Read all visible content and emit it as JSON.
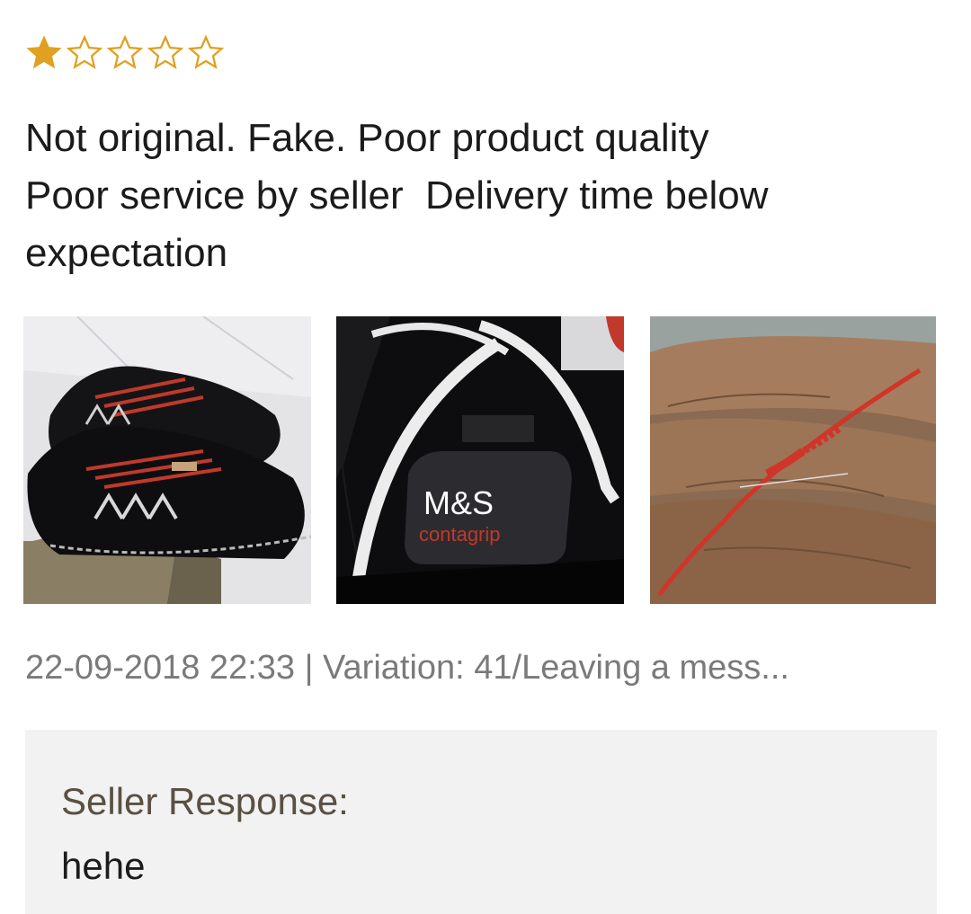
{
  "rating": {
    "value": 1,
    "max": 5,
    "filled_color": "#e0a020",
    "empty_color": "#e0a020"
  },
  "review": {
    "lines": [
      "Not original. Fake. Poor product quality",
      "Poor service by seller  Delivery time below",
      "expectation"
    ]
  },
  "photos": [
    {
      "icon": "black-sneakers-photo"
    },
    {
      "icon": "shoe-logo-closeup-photo",
      "logo_text": "M&S",
      "sub_text": "contagrip"
    },
    {
      "icon": "red-shoelace-in-hand-photo"
    }
  ],
  "meta": {
    "text": "22-09-2018 22:33 | Variation: 41/Leaving a mess..."
  },
  "seller_response": {
    "label": "Seller Response:",
    "text": "hehe"
  }
}
